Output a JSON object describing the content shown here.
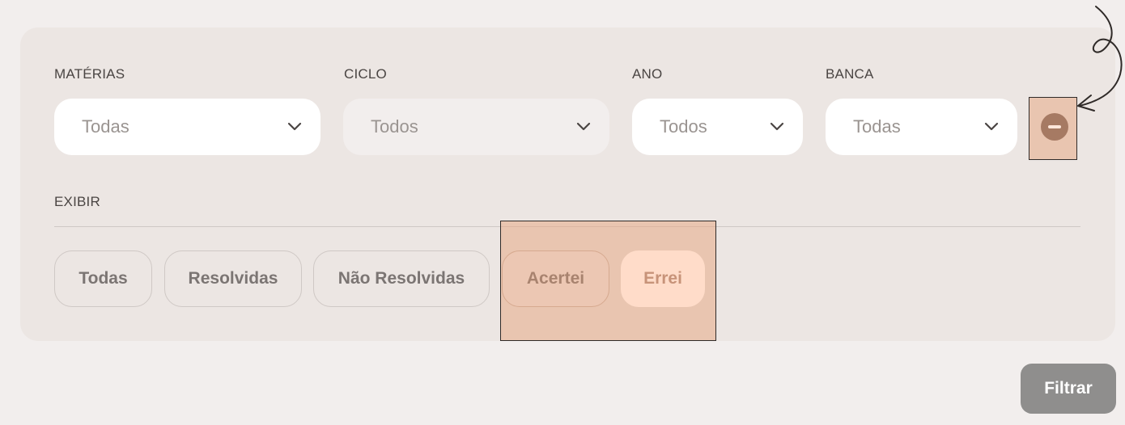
{
  "filters": {
    "materias": {
      "label": "MATÉRIAS",
      "value": "Todas"
    },
    "ciclo": {
      "label": "CICLO",
      "value": "Todos"
    },
    "ano": {
      "label": "ANO",
      "value": "Todos"
    },
    "banca": {
      "label": "BANCA",
      "value": "Todas"
    }
  },
  "exibir": {
    "label": "EXIBIR",
    "options": [
      "Todas",
      "Resolvidas",
      "Não Resolvidas",
      "Acertei",
      "Errei"
    ]
  },
  "actions": {
    "filter_label": "Filtrar"
  },
  "icons": {
    "chevron": "chevron-down-icon",
    "remove": "minus-circle-icon",
    "annotation": "curved-arrow-icon"
  },
  "colors": {
    "panel": "#ece6e3",
    "highlight": "#e8aa87",
    "remove_button": "#a67a63",
    "filter_button": "#8f8e8d"
  }
}
